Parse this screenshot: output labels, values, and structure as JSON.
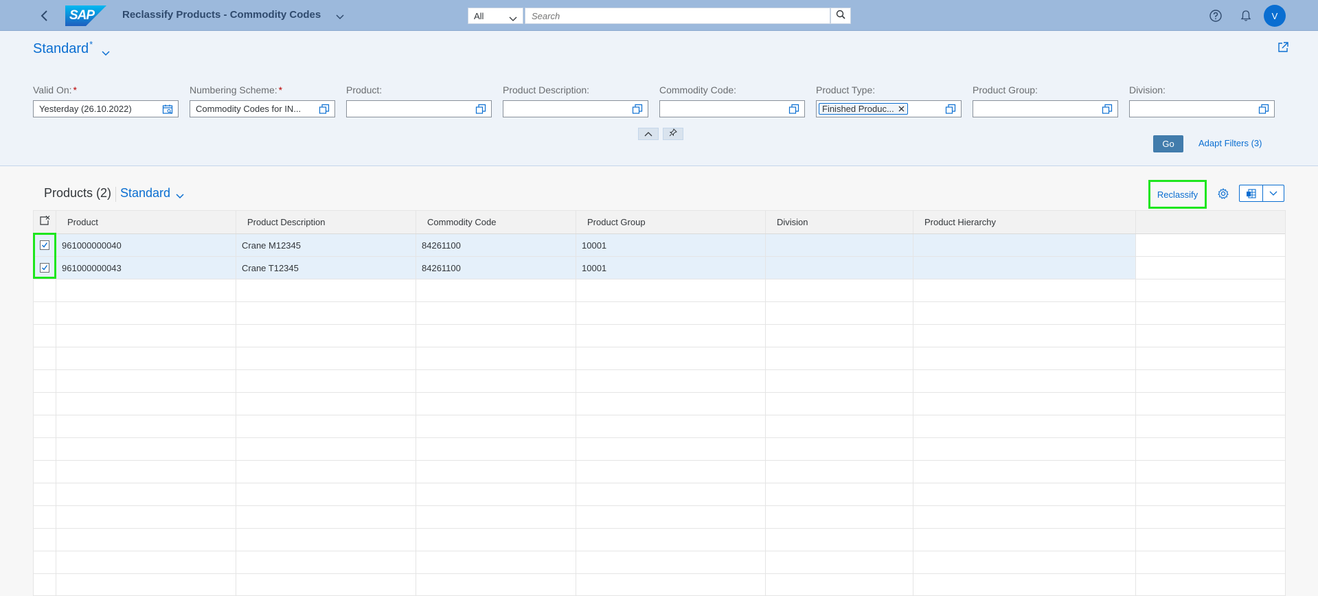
{
  "shell": {
    "title": "Reclassify Products - Commodity Codes",
    "search_scope": "All",
    "search_placeholder": "Search",
    "avatar_initial": "V",
    "logo_text": "SAP"
  },
  "filter_bar": {
    "variant_name": "Standard",
    "variant_modified": "*",
    "fields": [
      {
        "label": "Valid On:",
        "required": true,
        "value": "Yesterday (26.10.2022)",
        "token": false
      },
      {
        "label": "Numbering Scheme:",
        "required": true,
        "value": "Commodity Codes for IN...",
        "token": false
      },
      {
        "label": "Product:",
        "required": false,
        "value": "",
        "token": false
      },
      {
        "label": "Product Description:",
        "required": false,
        "value": "",
        "token": false
      },
      {
        "label": "Commodity Code:",
        "required": false,
        "value": "",
        "token": false
      },
      {
        "label": "Product Type:",
        "required": false,
        "value": "Finished Produc...",
        "token": true
      },
      {
        "label": "Product Group:",
        "required": false,
        "value": "",
        "token": false
      },
      {
        "label": "Division:",
        "required": false,
        "value": "",
        "token": false
      }
    ],
    "go_label": "Go",
    "adapt_filters_label": "Adapt Filters (3)",
    "required_marker": "*"
  },
  "table_toolbar": {
    "title": "Products (2)",
    "variant": "Standard",
    "reclassify_label": "Reclassify"
  },
  "table": {
    "columns": [
      "Product",
      "Product Description",
      "Commodity Code",
      "Product Group",
      "Division",
      "Product Hierarchy"
    ],
    "rows": [
      {
        "selected": true,
        "cells": [
          "961000000040",
          "Crane M12345",
          "84261100",
          "10001",
          "",
          ""
        ]
      },
      {
        "selected": true,
        "cells": [
          "961000000043",
          "Crane T12345",
          "84261100",
          "10001",
          "",
          ""
        ]
      }
    ],
    "empty_rows": 14
  },
  "colors": {
    "shell_bg": "#9cb9dc",
    "accent": "#0a6ed1",
    "highlight": "#1ee61e",
    "go_button": "#427cac",
    "selected_row": "#e5f0fa"
  }
}
